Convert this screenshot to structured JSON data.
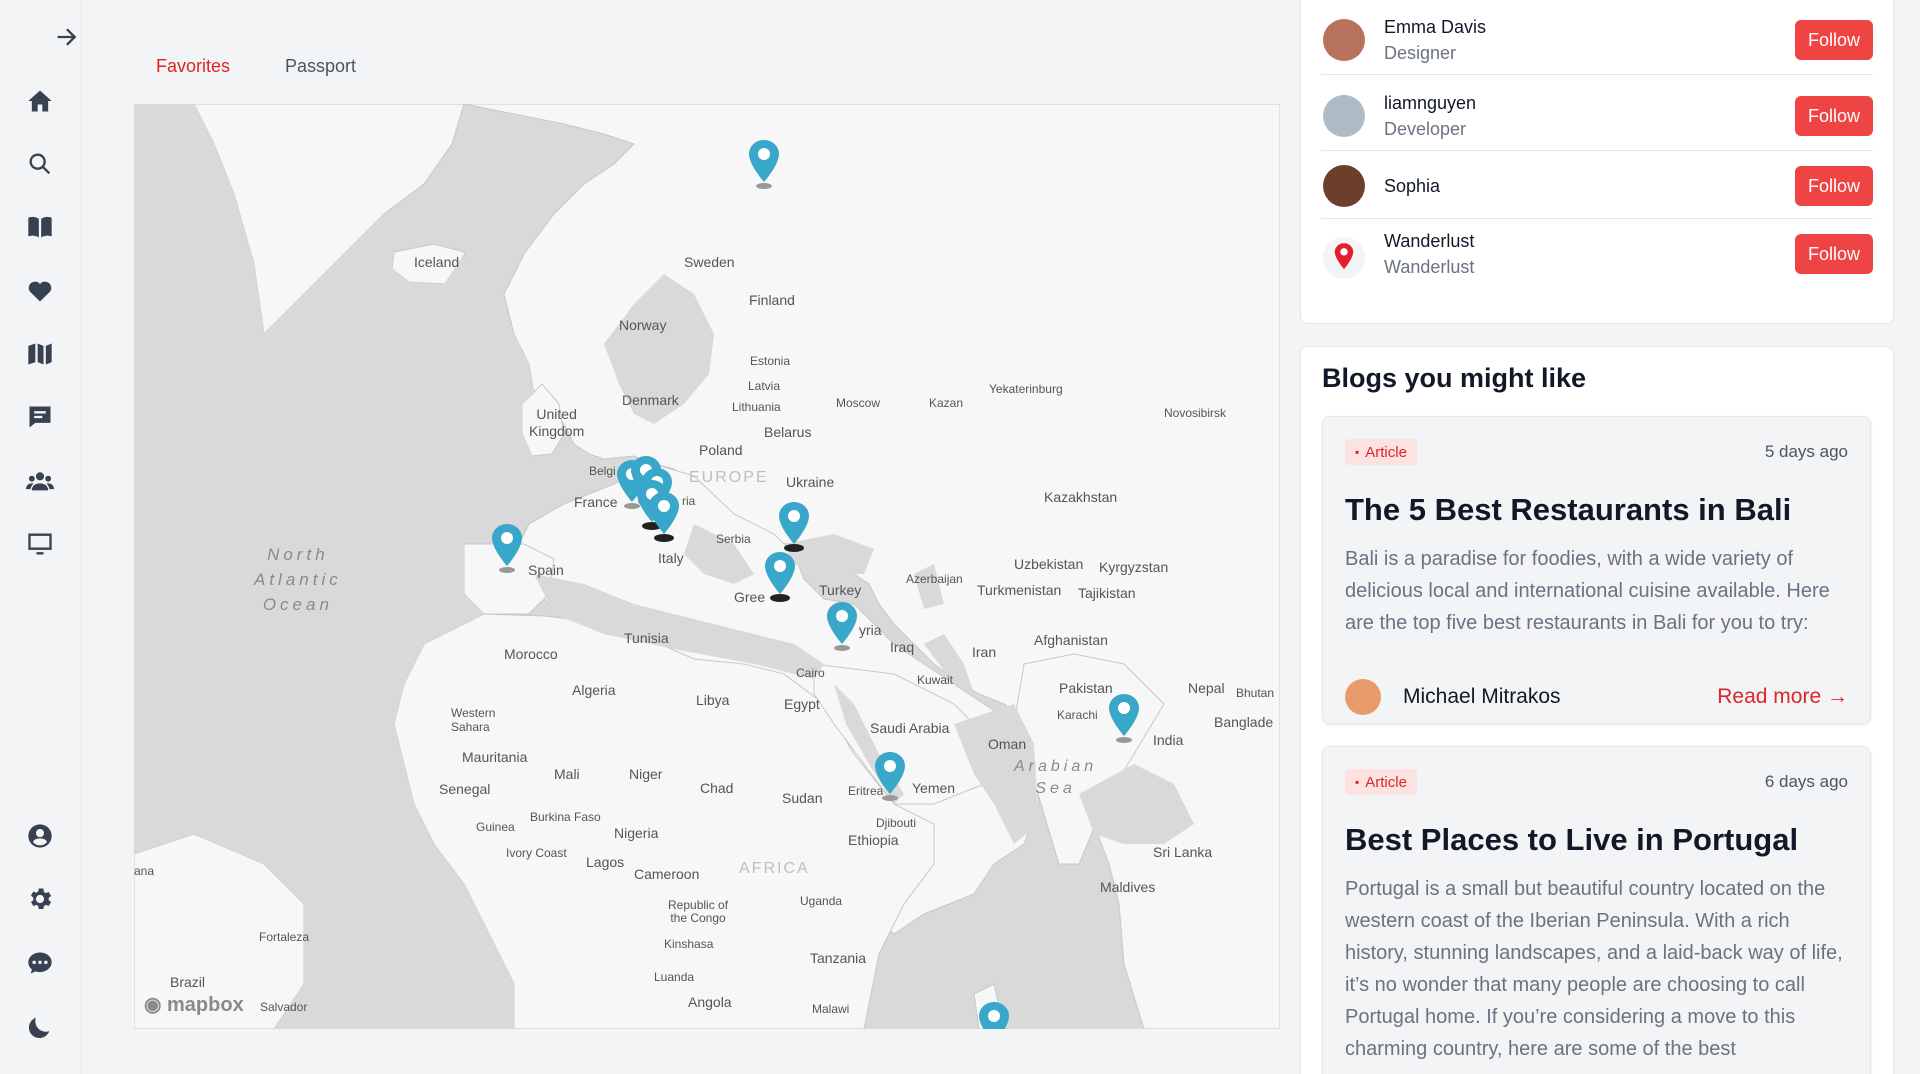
{
  "sidebar": {
    "icons": [
      "arrow-right-icon",
      "home-icon",
      "search-icon",
      "book-icon",
      "heart-icon",
      "map-icon",
      "chat-icon",
      "group-icon",
      "monitor-icon",
      "user-icon",
      "settings-icon",
      "message-icon",
      "moon-icon"
    ]
  },
  "tabs": [
    {
      "label": "Favorites",
      "active": true
    },
    {
      "label": "Passport",
      "active": false
    }
  ],
  "map": {
    "attribution": "mapbox",
    "labels": {
      "ocean": "North\nAtlantic\nOcean",
      "iceland": "Iceland",
      "sweden": "Sweden",
      "finland": "Finland",
      "norway": "Norway",
      "estonia": "Estonia",
      "latvia": "Latvia",
      "lithuania": "Lithuania",
      "denmark": "Denmark",
      "moscow": "Moscow",
      "kazan": "Kazan",
      "yekaterinburg": "Yekaterinburg",
      "novosibirsk": "Novosibirsk",
      "uk": "United\nKingdom",
      "belarus": "Belarus",
      "poland": "Poland",
      "europe": "EUROPE",
      "belgium": "Belgi",
      "ukraine": "Ukraine",
      "france": "France",
      "austria": "ria",
      "kazakhstan": "Kazakhstan",
      "serbia": "Serbia",
      "spain": "Spain",
      "italy": "Italy",
      "uzbekistan": "Uzbekistan",
      "kyrgyzstan": "Kyrgyzstan",
      "azerbaijan": "Azerbaijan",
      "turkey": "Turkey",
      "turkmenistan": "Turkmenistan",
      "tajikistan": "Tajikistan",
      "greece": "Gree",
      "syria": "yria",
      "tunisia": "Tunisia",
      "iraq": "Iraq",
      "iran": "Iran",
      "afghanistan": "Afghanistan",
      "morocco": "Morocco",
      "cairo": "Cairo",
      "kuwait": "Kuwait",
      "pakistan": "Pakistan",
      "nepal": "Nepal",
      "bhutan": "Bhutan",
      "algeria": "Algeria",
      "libya": "Libya",
      "egypt": "Egypt",
      "karachi": "Karachi",
      "bangladesh": "Banglade",
      "westernsahara": "Western\nSahara",
      "saudi": "Saudi Arabia",
      "oman": "Oman",
      "india": "India",
      "mauritania": "Mauritania",
      "arabiansea": "Arabian\nSea",
      "mali": "Mali",
      "niger": "Niger",
      "chad": "Chad",
      "senegal": "Senegal",
      "sudan": "Sudan",
      "eritrea": "Eritrea",
      "yemen": "Yemen",
      "burkina": "Burkina Faso",
      "guinea": "Guinea",
      "djibouti": "Djibouti",
      "nigeria": "Nigeria",
      "ethiopia": "Ethiopia",
      "ivorycoast": "Ivory Coast",
      "srilanka": "Sri Lanka",
      "ghana": "ana",
      "lagos": "Lagos",
      "africa": "AFRICA",
      "cameroon": "Cameroon",
      "maldives": "Maldives",
      "uganda": "Uganda",
      "congo": "Republic of\nthe Congo",
      "kinshasa": "Kinshasa",
      "fortaleza": "Fortaleza",
      "tanzania": "Tanzania",
      "brazil": "Brazil",
      "luanda": "Luanda",
      "salvador": "Salvador",
      "angola": "Angola",
      "malawi": "Malawi"
    }
  },
  "follow": [
    {
      "name": "Emma Davis",
      "role": "Designer",
      "button": "Follow"
    },
    {
      "name": "liamnguyen",
      "role": "Developer",
      "button": "Follow"
    },
    {
      "name": "Sophia",
      "role": "",
      "button": "Follow"
    },
    {
      "name": "Wanderlust",
      "role": "Wanderlust",
      "button": "Follow"
    }
  ],
  "blogs": {
    "title": "Blogs you might like",
    "items": [
      {
        "badge": "Article",
        "time": "5 days ago",
        "title": "The 5 Best Restaurants in Bali",
        "description": "Bali is a paradise for foodies, with a wide variety of delicious local and international cuisine available. Here are the top five best restaurants in Bali for you to try:",
        "author": "Michael Mitrakos",
        "read_more": "Read more"
      },
      {
        "badge": "Article",
        "time": "6 days ago",
        "title": "Best Places to Live in Portugal",
        "description": "Portugal is a small but beautiful country located on the western coast of the Iberian Peninsula. With a rich history, stunning landscapes, and a laid-back way of life, it’s no wonder that many people are choosing to call Portugal home. If you’re considering a move to this charming country, here are some of the best"
      }
    ]
  },
  "colors": {
    "accent": "#ef4444",
    "pin": "#38a7c9",
    "land": "#f7f7f7",
    "water": "#d9d9d9"
  }
}
